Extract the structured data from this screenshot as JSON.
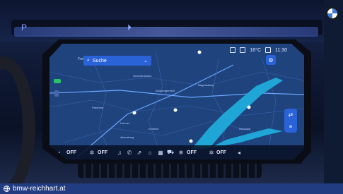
{
  "header": {
    "status": [
      "16°C",
      "11:30"
    ],
    "search_placeholder": "Suche",
    "left_label": "Freiungen"
  },
  "map": {
    "towns": [
      "Schmidmühlen",
      "Burglengenfeld",
      "Regensburg",
      "Parsberg",
      "Hemau",
      "Kelheim",
      "Neustadt",
      "Abensberg"
    ]
  },
  "dock": {
    "left_ac": "OFF",
    "right_ac": "OFF",
    "left_seat": "OFF",
    "right_seat": "OFF"
  },
  "footer": {
    "url": "bmw-reichhart.at"
  },
  "colors": {
    "accent": "#2a62d8",
    "footer_bg": "#223c82",
    "river": "#1fa6d6"
  }
}
